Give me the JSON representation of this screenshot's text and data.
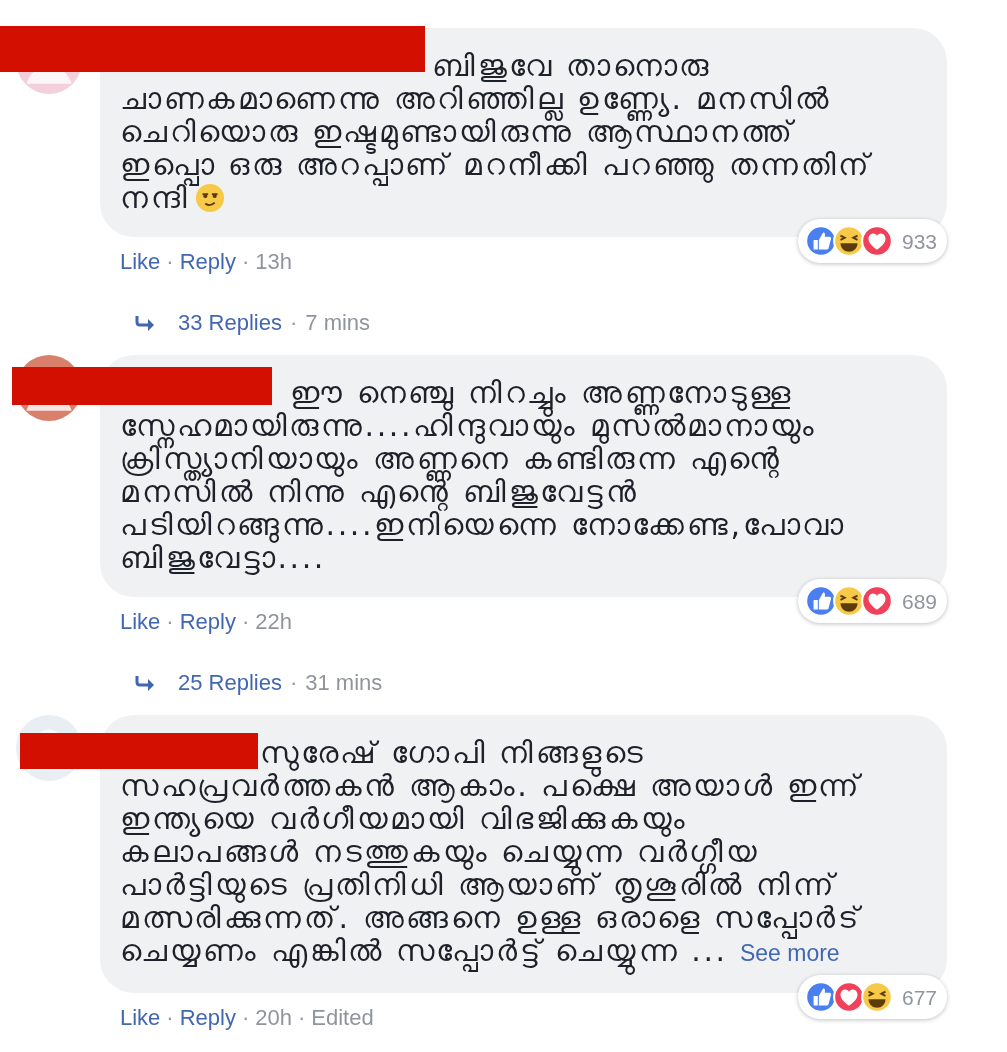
{
  "comments": [
    {
      "lines": [
        "ബിജുവേ താനൊരു",
        "ചാണകമാണെന്നു അറിഞ്ഞില്ല ഉണ്ണ്യേ. മനസിൽ",
        "ചെറിയൊരു ഇഷ്ടമുണ്ടായിരുന്നു ആസ്ഥാനത്ത്",
        "ഇപ്പൊ ഒരു അറപ്പാണ് മറനീക്കി പറഞ്ഞു തന്നതിന്",
        "നന്ദി"
      ],
      "ends_with_emoji": true,
      "reactions": [
        {
          "kind": "like"
        },
        {
          "kind": "haha"
        },
        {
          "kind": "love"
        }
      ],
      "reaction_count": "933",
      "actions": [
        {
          "kind": "link",
          "text": "Like"
        },
        {
          "kind": "sep",
          "text": "·"
        },
        {
          "kind": "link",
          "text": "Reply"
        },
        {
          "kind": "sep",
          "text": "·"
        },
        {
          "kind": "meta",
          "text": "13h"
        }
      ],
      "replies": {
        "count": "33 Replies",
        "sep": "·",
        "time": "7 mins"
      }
    },
    {
      "lines": [
        "ഈ നെഞ്ചു നിറച്ചും അണ്ണനോടുള്ള",
        "സ്നേഹമായിരുന്നു....ഹിന്ദുവായും മുസൽമാനായും",
        "ക്രിസ്ത്യാനിയായും അണ്ണനെ കണ്ടിരുന്ന എന്റെ",
        "മനസിൽ നിന്നു എന്റെ ബിജുവേട്ടൻ",
        "പടിയിറങ്ങുന്നു....ഇനിയെന്നെ നോക്കേണ്ട,പോവാ",
        "ബിജുവേട്ടാ...."
      ],
      "ends_with_emoji": false,
      "reactions": [
        {
          "kind": "like"
        },
        {
          "kind": "haha"
        },
        {
          "kind": "love"
        }
      ],
      "reaction_count": "689",
      "actions": [
        {
          "kind": "link",
          "text": "Like"
        },
        {
          "kind": "sep",
          "text": "·"
        },
        {
          "kind": "link",
          "text": "Reply"
        },
        {
          "kind": "sep",
          "text": "·"
        },
        {
          "kind": "meta",
          "text": "22h"
        }
      ],
      "replies": {
        "count": "25 Replies",
        "sep": "·",
        "time": "31 mins"
      }
    },
    {
      "lines": [
        "സുരേഷ് ഗോപി നിങ്ങളുടെ",
        "സഹപ്രവർത്തകൻ ആകാം. പക്ഷെ അയാൾ ഇന്ന്",
        "ഇന്ത്യയെ വർഗീയമായി വിഭജിക്കുകയും",
        "കലാപങ്ങൾ നടത്തുകയും ചെയ്യുന്ന വർഗ്ഗീയ",
        "പാർട്ടിയുടെ പ്രതിനിധി ആയാണ് തൃശൂരിൽ നിന്ന്",
        "മത്സരിക്കുന്നത്. അങ്ങനെ ഉള്ള ഒരാളെ സപ്പോർട്",
        "ചെയ്യണം എങ്കിൽ സപ്പോർട്ട് ചെയ്യുന്ന ..."
      ],
      "see_more": "See more",
      "ends_with_emoji": false,
      "reactions": [
        {
          "kind": "like"
        },
        {
          "kind": "love"
        },
        {
          "kind": "haha"
        }
      ],
      "reaction_count": "677",
      "actions": [
        {
          "kind": "link",
          "text": "Like"
        },
        {
          "kind": "sep",
          "text": "·"
        },
        {
          "kind": "link",
          "text": "Reply"
        },
        {
          "kind": "sep",
          "text": "·"
        },
        {
          "kind": "meta",
          "text": "20h"
        },
        {
          "kind": "sep",
          "text": "·"
        },
        {
          "kind": "meta",
          "text": "Edited"
        }
      ]
    }
  ]
}
